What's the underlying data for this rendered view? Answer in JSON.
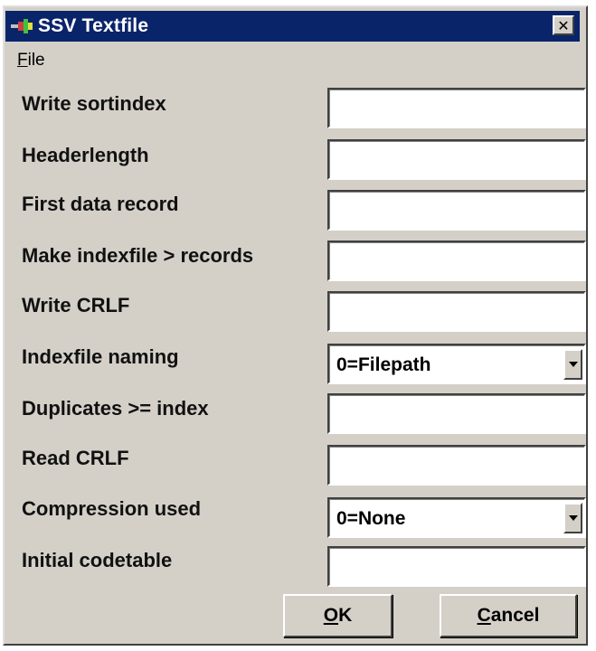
{
  "window": {
    "title": "SSV Textfile",
    "close_symbol": "✕"
  },
  "menu": {
    "file": "File"
  },
  "fields": [
    {
      "label": "Write sortindex",
      "value": ""
    },
    {
      "label": "Headerlength",
      "value": ""
    },
    {
      "label": "First data record",
      "value": ""
    },
    {
      "label": "Make indexfile > records",
      "value": ""
    },
    {
      "label": "Write CRLF",
      "value": ""
    },
    {
      "label": "Indexfile naming",
      "value": "0=Filepath"
    },
    {
      "label": "Duplicates >= index",
      "value": ""
    },
    {
      "label": "Read CRLF",
      "value": ""
    },
    {
      "label": "Compression used",
      "value": "0=None"
    },
    {
      "label": "Initial codetable",
      "value": ""
    }
  ],
  "buttons": {
    "ok": "OK",
    "cancel": "Cancel"
  }
}
